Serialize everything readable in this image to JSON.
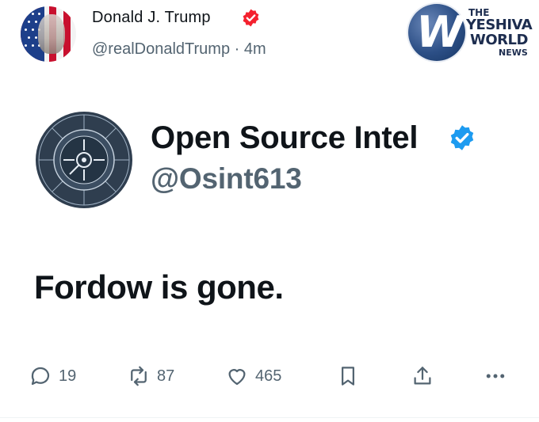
{
  "post": {
    "author_name": "Donald J. Trump",
    "author_handle": "@realDonaldTrump",
    "separator": "·",
    "time_ago": "4m",
    "verified_badge_color": "#f4212e"
  },
  "watermark": {
    "line1": "THE",
    "line2": "YESHIVA",
    "line3": "WORLD",
    "line4": "NEWS"
  },
  "embedded": {
    "name": "Open Source Intel",
    "handle": "@Osint613",
    "verified_badge_color": "#1d9bf0",
    "body": "Fordow is gone."
  },
  "actions": {
    "replies": "19",
    "reposts": "87",
    "likes": "465",
    "icons": [
      "reply-icon",
      "repost-icon",
      "like-icon",
      "bookmark-icon",
      "share-icon",
      "more-icon"
    ]
  }
}
